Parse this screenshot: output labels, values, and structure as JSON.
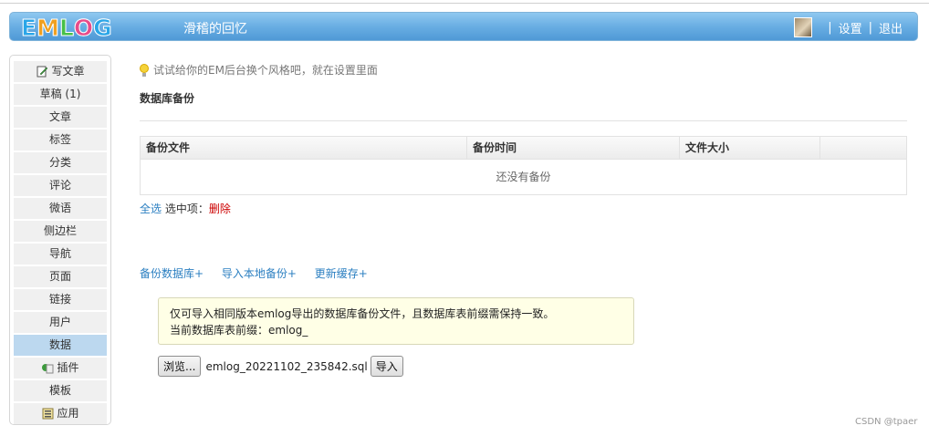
{
  "header": {
    "logo_letters": [
      {
        "ch": "E",
        "color": "#2aa6e8"
      },
      {
        "ch": "M",
        "color": "#f0a020"
      },
      {
        "ch": "L",
        "color": "#47c048"
      },
      {
        "ch": "O",
        "color": "#e84b8a"
      },
      {
        "ch": "G",
        "color": "#2aa6e8"
      }
    ],
    "blog_title": "滑稽的回忆",
    "settings": "设置",
    "logout": "退出",
    "separator": "|"
  },
  "sidebar": {
    "items": [
      {
        "label": "写文章",
        "icon": "pencil-icon"
      },
      {
        "label": "草稿 (1)"
      },
      {
        "label": "文章"
      },
      {
        "label": "标签"
      },
      {
        "label": "分类"
      },
      {
        "label": "评论"
      },
      {
        "label": "微语"
      },
      {
        "label": "侧边栏"
      },
      {
        "label": "导航"
      },
      {
        "label": "页面"
      },
      {
        "label": "链接"
      },
      {
        "label": "用户"
      },
      {
        "label": "数据",
        "active": true
      },
      {
        "label": "插件",
        "icon": "plugin-icon"
      },
      {
        "label": "模板"
      },
      {
        "label": "应用",
        "icon": "app-icon"
      }
    ]
  },
  "main": {
    "tip": "试试给你的EM后台换个风格吧，就在设置里面",
    "title": "数据库备份",
    "table": {
      "columns": [
        "备份文件",
        "备份时间",
        "文件大小",
        ""
      ],
      "empty_text": "还没有备份"
    },
    "select_all": "全选",
    "selected_label": "选中项：",
    "delete": "删除",
    "actions": [
      "备份数据库+",
      "导入本地备份+",
      "更新缓存+"
    ],
    "notice_line1": "仅可导入相同版本emlog导出的数据库备份文件，且数据库表前缀需保持一致。",
    "notice_line2": "当前数据库表前缀：emlog_",
    "browse_button": "浏览...",
    "file_name": "emlog_20221102_235842.sql",
    "import_button": "导入"
  },
  "watermark": "CSDN @tpaer",
  "colors": {
    "header_blue": "#5ba3de",
    "link_blue": "#2b7fc1",
    "delete_red": "#cc0000",
    "active_nav": "#bcd8ef",
    "notice_bg": "#ffffe6"
  }
}
